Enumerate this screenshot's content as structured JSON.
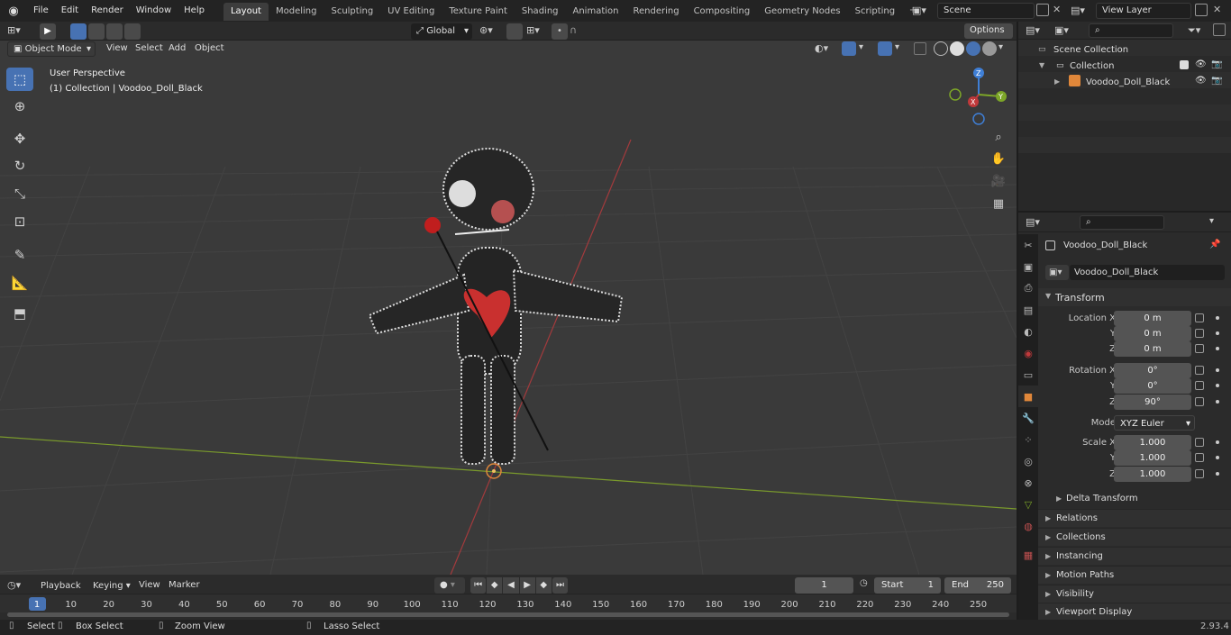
{
  "menus": [
    "File",
    "Edit",
    "Render",
    "Window",
    "Help"
  ],
  "workspaces": [
    "Layout",
    "Modeling",
    "Sculpting",
    "UV Editing",
    "Texture Paint",
    "Shading",
    "Animation",
    "Rendering",
    "Compositing",
    "Geometry Nodes",
    "Scripting"
  ],
  "active_workspace": "Layout",
  "scene": "Scene",
  "view_layer": "View Layer",
  "header": {
    "mode": "Object Mode",
    "view": "View",
    "select": "Select",
    "add": "Add",
    "object": "Object",
    "transform_orientation": "Global",
    "options": "Options"
  },
  "viewport": {
    "perspective": "User Perspective",
    "collection_info": "(1) Collection | Voodoo_Doll_Black"
  },
  "gizmo": {
    "x": "X",
    "y": "Y",
    "z": "Z"
  },
  "outliner": {
    "root": "Scene Collection",
    "collection": "Collection",
    "object": "Voodoo_Doll_Black"
  },
  "properties": {
    "object_name": "Voodoo_Doll_Black",
    "object_field": "Voodoo_Doll_Black",
    "transform_title": "Transform",
    "location_label": "Location X",
    "y_label": "Y",
    "z_label": "Z",
    "location": [
      "0 m",
      "0 m",
      "0 m"
    ],
    "rotation_label": "Rotation X",
    "rotation": [
      "0°",
      "0°",
      "90°"
    ],
    "mode_label": "Mode",
    "mode_value": "XYZ Euler",
    "scale_label": "Scale X",
    "scale": [
      "1.000",
      "1.000",
      "1.000"
    ],
    "delta": "Delta Transform",
    "panels": [
      "Relations",
      "Collections",
      "Instancing",
      "Motion Paths",
      "Visibility",
      "Viewport Display"
    ]
  },
  "timeline": {
    "playback": "Playback",
    "keying": "Keying",
    "view": "View",
    "marker": "Marker",
    "current_frame": "1",
    "start_label": "Start",
    "start": "1",
    "end_label": "End",
    "end": "250",
    "ticks": [
      "1",
      "10",
      "20",
      "30",
      "40",
      "50",
      "60",
      "70",
      "80",
      "90",
      "100",
      "110",
      "120",
      "130",
      "140",
      "150",
      "160",
      "170",
      "180",
      "190",
      "200",
      "210",
      "220",
      "230",
      "240",
      "250"
    ]
  },
  "status": {
    "select": "Select",
    "box_select": "Box Select",
    "zoom_view": "Zoom View",
    "lasso_select": "Lasso Select",
    "version": "2.93.4"
  },
  "colors": {
    "accent": "#4772b3",
    "x_axis": "#c0393b",
    "y_axis": "#7da628",
    "z_axis": "#3f7fd6",
    "object_orange": "#e0873a"
  }
}
